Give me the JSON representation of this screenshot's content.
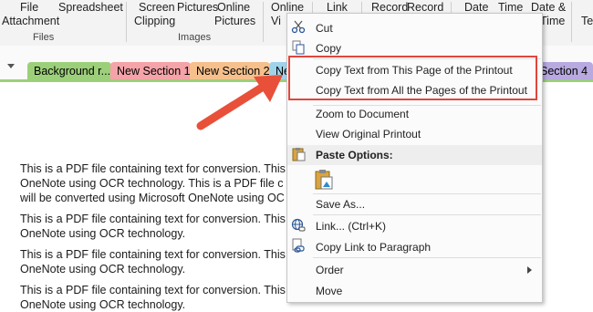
{
  "ribbon": {
    "file_attachment": [
      "File",
      "Attachment"
    ],
    "spreadsheet": "Spreadsheet",
    "screen_clipping": [
      "Screen",
      "Clipping"
    ],
    "pictures": "Pictures",
    "online_pictures": [
      "Online",
      "Pictures"
    ],
    "online_video": [
      "Online",
      "Vi"
    ],
    "link": "Link",
    "record_1": "Record",
    "record_2": "Record",
    "date": "Date",
    "time": "Time",
    "date_and": "Date &",
    "date_and_2": "Time",
    "te": "Te",
    "group_files": "Files",
    "group_images": "Images"
  },
  "tabs": {
    "background": "Background r...",
    "new_section_1": "New Section 1",
    "new_section_2": "New Section 2",
    "partial_ne": "Ne",
    "section_4": "Section 4"
  },
  "page_text": [
    "This is a PDF file containing text for conversion. This",
    "OneNote using OCR technology. This is a PDF file c",
    "will be converted using Microsoft OneNote using OC",
    "This is a PDF file containing text for conversion. This",
    "OneNote using OCR technology.",
    "This is a PDF file containing text for conversion. This",
    "OneNote using OCR technology.",
    "This is a PDF file containing text for conversion. This",
    "OneNote using OCR technology."
  ],
  "context_menu": {
    "cut": "Cut",
    "copy": "Copy",
    "copy_text_page": "Copy Text from This Page of the Printout",
    "copy_text_all": "Copy Text from All the Pages of the Printout",
    "zoom_to_document": "Zoom to Document",
    "view_original_printout": "View Original Printout",
    "paste_options": "Paste Options:",
    "save_as": "Save As...",
    "link": "Link...  (Ctrl+K)",
    "copy_link_paragraph": "Copy Link to Paragraph",
    "order": "Order",
    "move": "Move"
  },
  "colors": {
    "highlight": "#e0473d",
    "arrow": "#e8503a",
    "tab_green": "#9ccf7a",
    "tab_pink": "#f4a3a8",
    "tab_orange": "#f6c08d",
    "tab_blue": "#9fd3ea",
    "tab_purple": "#b8a9e0"
  },
  "icons": [
    "scissors-icon",
    "copy-icon",
    "paste-icon",
    "paste-keep-formatting-icon",
    "link-icon",
    "copy-link-icon",
    "submenu-arrow-icon",
    "dropdown-arrow-icon"
  ]
}
